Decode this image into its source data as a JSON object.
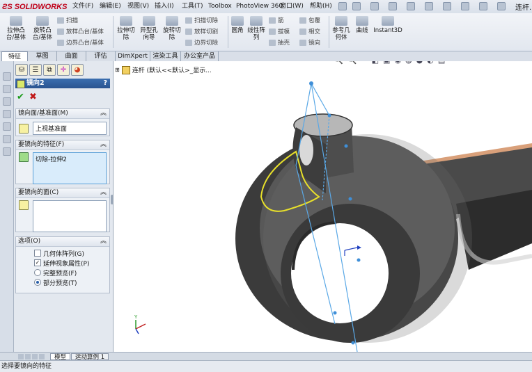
{
  "app": {
    "logo_text": "SOLIDWORKS",
    "doc_title": "连杆..."
  },
  "menu": [
    "文件(F)",
    "编辑(E)",
    "视图(V)",
    "插入(I)",
    "工具(T)",
    "Toolbox",
    "PhotoView 360",
    "窗口(W)",
    "帮助(H)"
  ],
  "commands": {
    "extrude_boss": "拉伸凸台/基体",
    "revolve_boss": "旋转凸台/基体",
    "sweep": "扫描",
    "loft": "放样凸台/基体",
    "boundary_boss": "边界凸台/基体",
    "extrude_cut": "拉伸切除",
    "hole_wizard": "异型孔向导",
    "revolve_cut": "旋转切除",
    "swept_cut": "扫描切除",
    "lofted_cut": "放样切割",
    "boundary_cut": "边界切除",
    "fillet": "圆角",
    "linear_pattern": "线性阵列",
    "rib": "筋",
    "draft": "拔模",
    "shell": "抽壳",
    "wrap": "包覆",
    "intersect": "相交",
    "mirror": "镜向",
    "ref_geometry": "参考几何体",
    "curves": "曲线",
    "instant3d": "Instant3D"
  },
  "tabs": [
    "特征",
    "草图",
    "曲面",
    "评估",
    "DimXpert",
    "渲染工具",
    "办公室产品"
  ],
  "property_manager": {
    "title": "镜向2",
    "help": "?",
    "ok": "✔",
    "cancel": "✖",
    "mirror_plane": {
      "header": "镜向面/基准面(M)",
      "value": "上视基准面"
    },
    "features": {
      "header": "要镜向的特征(F)",
      "value": "切除-拉伸2"
    },
    "faces": {
      "header": "要镜向的面(C)",
      "value": ""
    },
    "options": {
      "header": "选项(O)",
      "items": [
        {
          "label": "几何体阵列(G)",
          "type": "checkbox",
          "checked": false
        },
        {
          "label": "延伸视象属性(P)",
          "type": "checkbox",
          "checked": true
        },
        {
          "label": "完整预览(F)",
          "type": "radio",
          "checked": false
        },
        {
          "label": "部分预览(T)",
          "type": "radio",
          "checked": true
        }
      ]
    }
  },
  "tree": {
    "root": "连杆 (默认<<默认>_显示..."
  },
  "bottom_tabs": [
    "模型",
    "运动算例 1"
  ],
  "status": "选择要镜向的特征",
  "triad": {
    "y": "Y"
  },
  "colors": {
    "title_bar": "#2a5490",
    "accent_red": "#c00018",
    "part_dark": "#3a3a3a",
    "preview_yellow": "#e8e02a",
    "plane_blue": "#5aa8e6"
  }
}
